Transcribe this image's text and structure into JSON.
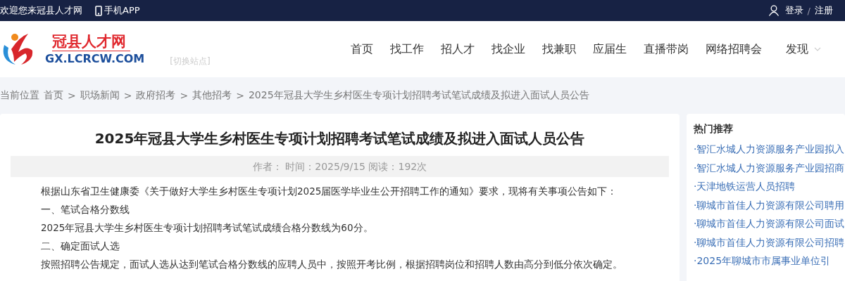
{
  "topbar": {
    "welcome": "欢迎您来冠县人才网",
    "app_link": "手机APP",
    "login": "登录",
    "separator": "/",
    "register": "注册"
  },
  "header": {
    "logo_title": "冠县人才网",
    "logo_domain": "GX.LCRCW.COM",
    "switch_site": "[切换站点]",
    "nav": [
      {
        "label": "首页"
      },
      {
        "label": "找工作"
      },
      {
        "label": "招人才"
      },
      {
        "label": "找企业"
      },
      {
        "label": "找兼职"
      },
      {
        "label": "应届生"
      },
      {
        "label": "直播带岗"
      },
      {
        "label": "网络招聘会"
      },
      {
        "label": "发现",
        "dropdown": true
      }
    ]
  },
  "breadcrumb": {
    "prefix": "当前位置",
    "separator": ">",
    "items": [
      "首页",
      "职场新闻",
      "政府招考",
      "其他招考",
      "2025年冠县大学生乡村医生专项计划招聘考试笔试成绩及拟进入面试人员公告"
    ]
  },
  "article": {
    "title": "2025年冠县大学生乡村医生专项计划招聘考试笔试成绩及拟进入面试人员公告",
    "meta": "作者：  时间：2025/9/15 阅读：192次",
    "paragraphs": [
      {
        "text": "根据山东省卫生健康委《关于做好大学生乡村医生专项计划2025届医学毕业生公开招聘工作的通知》要求，现将有关事项公告如下："
      },
      {
        "text": "一、笔试合格分数线"
      },
      {
        "text": "2025年冠县大学生乡村医生专项计划招聘考试笔试成绩合格分数线为60分。"
      },
      {
        "text": "二、确定面试人选"
      },
      {
        "text": "按照招聘公告规定，面试人选从达到笔试合格分数线的应聘人员中，按照开考比例，根据招聘岗位和招聘人数由高分到低分依次确定。"
      }
    ]
  },
  "sidebar": {
    "title": "热门推荐",
    "items": [
      "·智汇水城人力资源服务产业园拟入",
      "·智汇水城人力资源服务产业园招商",
      "·天津地铁运营人员招聘",
      "·聊城市首佳人力资源有限公司聘用",
      "·聊城市首佳人力资源有限公司面试",
      "·聊城市首佳人力资源有限公司招聘",
      "·2025年聊城市市属事业单位引"
    ]
  }
}
